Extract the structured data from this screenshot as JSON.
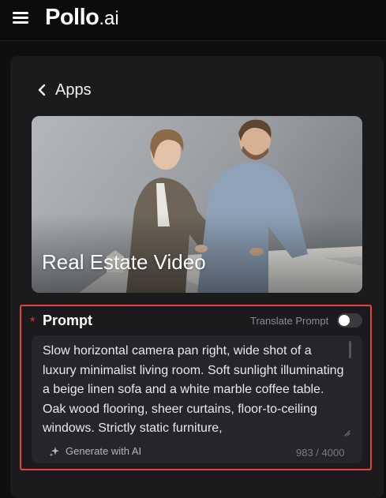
{
  "header": {
    "logo_main": "Pollo",
    "logo_sub": ".ai"
  },
  "nav": {
    "back_label": "Apps"
  },
  "hero": {
    "title": "Real Estate Video"
  },
  "prompt": {
    "required_mark": "*",
    "label": "Prompt",
    "translate_label": "Translate Prompt",
    "translate_enabled": false,
    "text": "Slow horizontal camera pan right, wide shot of a luxury minimalist living room. Soft sunlight illuminating a beige linen sofa and a white marble coffee table. Oak wood flooring, sheer curtains, floor-to-ceiling windows. Strictly static furniture,",
    "generate_label": "Generate with AI",
    "counter": "983 / 4000"
  },
  "colors": {
    "accent_border": "#e0463b",
    "required": "#e53935",
    "panel": "#1b1b1e",
    "background": "#0f0f10"
  },
  "icons": [
    "menu-icon",
    "chevron-left-icon",
    "sparkle-icon",
    "resize-handle-icon"
  ]
}
